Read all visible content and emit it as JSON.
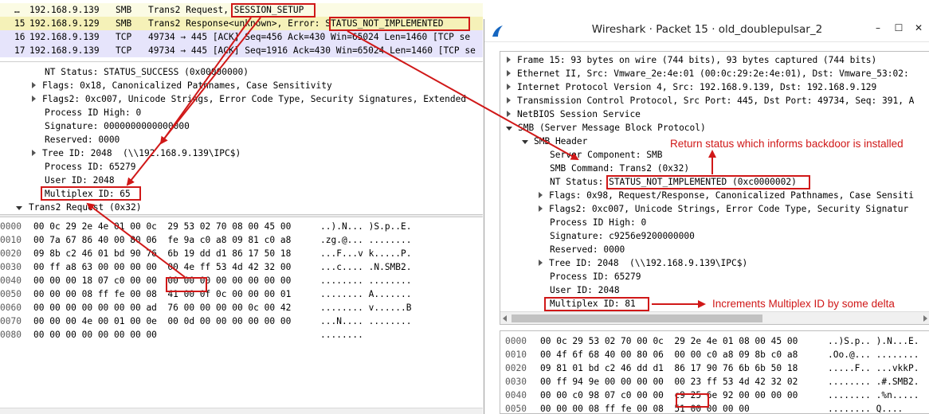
{
  "packet_list": {
    "rows": [
      {
        "no": "…",
        "src": "192.168.9.139",
        "proto": "SMB",
        "info": "Trans2 Request, SESSION_SETUP"
      },
      {
        "no": "15",
        "src": "192.168.9.129",
        "proto": "SMB",
        "info": "Trans2 Response<unknown>, Error: STATUS_NOT_IMPLEMENTED"
      },
      {
        "no": "16",
        "src": "192.168.9.139",
        "proto": "TCP",
        "info": "49734 → 445 [ACK] Seq=456 Ack=430 Win=65024 Len=1460 [TCP se"
      },
      {
        "no": "17",
        "src": "192.168.9.139",
        "proto": "TCP",
        "info": "49734 → 445 [ACK] Seq=1916 Ack=430 Win=65024 Len=1460 [TCP se"
      }
    ]
  },
  "left_details": [
    "NT Status: STATUS_SUCCESS (0x00000000)",
    "Flags: 0x18, Canonicalized Pathnames, Case Sensitivity",
    "Flags2: 0xc007, Unicode Strings, Error Code Type, Security Signatures, Extended",
    "Process ID High: 0",
    "Signature: 0000000000000000",
    "Reserved: 0000",
    "Tree ID: 2048  (\\\\192.168.9.139\\IPC$)",
    "Process ID: 65279",
    "User ID: 2048",
    "Multiplex ID: 65",
    "Trans2 Request (0x32)"
  ],
  "left_hex": [
    {
      "off": "0000",
      "hex": "00 0c 29 2e 4e 01 00 0c  29 53 02 70 08 00 45 00",
      "ascii": "..).N... )S.p..E."
    },
    {
      "off": "0010",
      "hex": "00 7a 67 86 40 00 80 06  fe 9a c0 a8 09 81 c0 a8",
      "ascii": ".zg.@... ........"
    },
    {
      "off": "0020",
      "hex": "09 8b c2 46 01 bd 90 76  6b 19 dd d1 86 17 50 18",
      "ascii": "...F...v k.....P."
    },
    {
      "off": "0030",
      "hex": "00 ff a8 63 00 00 00 00  00 4e ff 53 4d 42 32 00",
      "ascii": "...c.... .N.SMB2."
    },
    {
      "off": "0040",
      "hex": "00 00 00 18 07 c0 00 00  00 00 00 00 00 00 00 00",
      "ascii": "........ ........"
    },
    {
      "off": "0050",
      "hex": "00 00 00 08 ff fe 00 08  41 00 0f 0c 00 00 00 01",
      "ascii": "........ A......."
    },
    {
      "off": "0060",
      "hex": "00 00 00 00 00 00 00 ad  76 00 00 00 00 0c 00 42",
      "ascii": "........ v......B"
    },
    {
      "off": "0070",
      "hex": "00 00 00 4e 00 01 00 0e  00 0d 00 00 00 00 00 00",
      "ascii": "...N.... ........"
    },
    {
      "off": "0080",
      "hex": "00 00 00 00 00 00 00 00",
      "ascii": "........"
    }
  ],
  "window": {
    "title": "Wireshark · Packet 15 · old_doublepulsar_2",
    "minimize_glyph": "–",
    "maximize_glyph": "☐",
    "close_glyph": "✕"
  },
  "right_tree": [
    "Frame 15: 93 bytes on wire (744 bits), 93 bytes captured (744 bits)",
    "Ethernet II, Src: Vmware_2e:4e:01 (00:0c:29:2e:4e:01), Dst: Vmware_53:02:",
    "Internet Protocol Version 4, Src: 192.168.9.139, Dst: 192.168.9.129",
    "Transmission Control Protocol, Src Port: 445, Dst Port: 49734, Seq: 391, A",
    "NetBIOS Session Service",
    "SMB (Server Message Block Protocol)",
    "SMB Header",
    "Server Component: SMB",
    "SMB Command: Trans2 (0x32)",
    "NT Status: STATUS_NOT_IMPLEMENTED (0xc0000002)",
    "Flags: 0x98, Request/Response, Canonicalized Pathnames, Case Sensiti",
    "Flags2: 0xc007, Unicode Strings, Error Code Type, Security Signatur",
    "Process ID High: 0",
    "Signature: c9256e9200000000",
    "Reserved: 0000",
    "Tree ID: 2048  (\\\\192.168.9.139\\IPC$)",
    "Process ID: 65279",
    "User ID: 2048",
    "Multiplex ID: 81"
  ],
  "right_hex": [
    {
      "off": "0000",
      "hex": "00 0c 29 53 02 70 00 0c  29 2e 4e 01 08 00 45 00",
      "ascii": "..)S.p.. ).N...E."
    },
    {
      "off": "0010",
      "hex": "00 4f 6f 68 40 00 80 06  00 00 c0 a8 09 8b c0 a8",
      "ascii": ".Oo.@... ........"
    },
    {
      "off": "0020",
      "hex": "09 81 01 bd c2 46 dd d1  86 17 90 76 6b 6b 50 18",
      "ascii": ".....F.. ...vkkP."
    },
    {
      "off": "0030",
      "hex": "00 ff 94 9e 00 00 00 00  00 23 ff 53 4d 42 32 02",
      "ascii": "........ .#.SMB2."
    },
    {
      "off": "0040",
      "hex": "00 00 c0 98 07 c0 00 00  c9 25 6e 92 00 00 00 00",
      "ascii": "........ .%n....."
    },
    {
      "off": "0050",
      "hex": "00 00 00 08 ff fe 00 08  51 00 00 00 00",
      "ascii": "........ Q...."
    }
  ],
  "annotations": {
    "status": "Return status which informs backdoor is installed",
    "multiplex": "Increments Multiplex ID by some delta"
  },
  "colors": {
    "highlight_red": "#d01818",
    "row_selected": "#f5f1b8",
    "row_tcp": "#e6e4fb",
    "row_smb": "#fbfbe4"
  }
}
